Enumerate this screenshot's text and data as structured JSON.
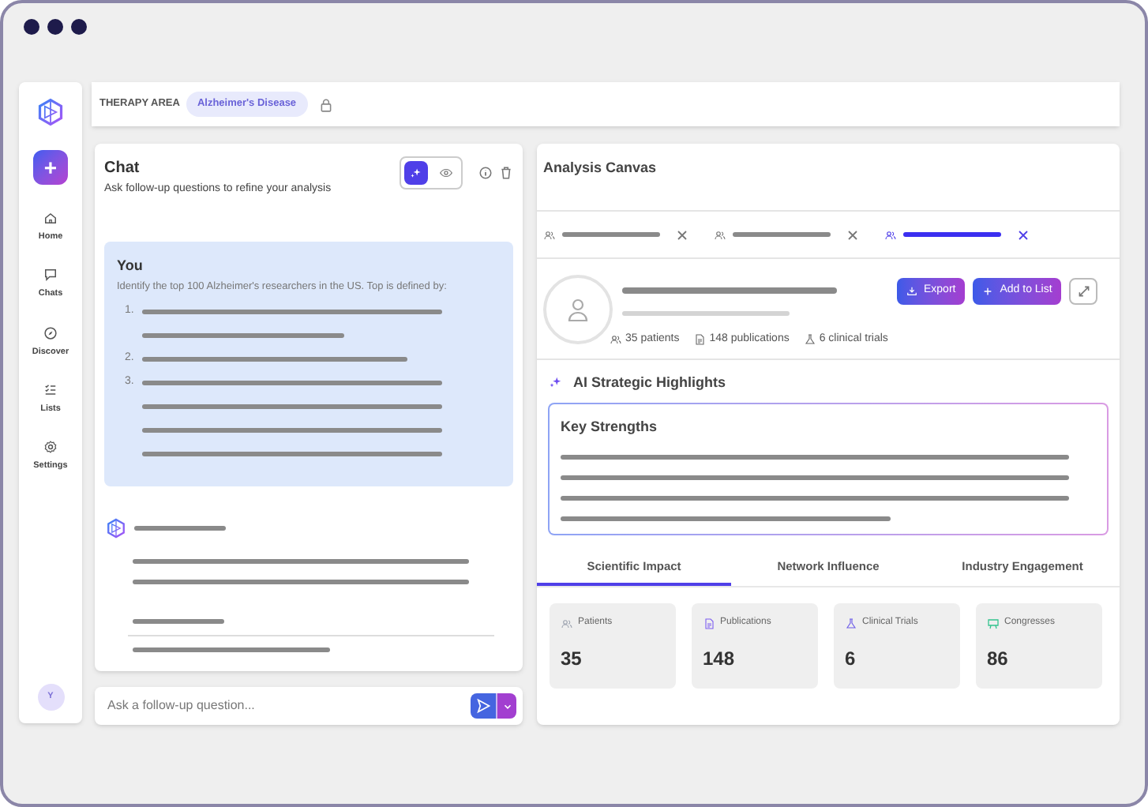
{
  "sidebar": {
    "new_button": "+",
    "items": [
      {
        "label": "Home",
        "kind": "home"
      },
      {
        "label": "Chats",
        "kind": "chats"
      },
      {
        "label": "Discover",
        "kind": "discover"
      },
      {
        "label": "Lists",
        "kind": "lists"
      },
      {
        "label": "Settings",
        "kind": "settings"
      }
    ],
    "avatar": "Y"
  },
  "header": {
    "label": "THERAPY AREA",
    "chip": "Alzheimer's Disease"
  },
  "chat": {
    "title": "Chat",
    "subtitle": "Ask follow-up questions to refine your analysis",
    "modes": [
      {
        "kind": "ai",
        "selected": true
      },
      {
        "kind": "view",
        "selected": false
      }
    ],
    "user_message": {
      "author": "You",
      "text": "Identify the top 100 Alzheimer's researchers in the US. Top is defined by:",
      "list_markers": [
        "1.",
        "2.",
        "3."
      ]
    },
    "input": {
      "placeholder": "Ask a follow-up question..."
    }
  },
  "canvas": {
    "title": "Analysis Canvas",
    "tabs": [
      {
        "selected": false
      },
      {
        "selected": false
      },
      {
        "selected": true
      }
    ],
    "stats": [
      {
        "kind": "patients",
        "text": "35 patients"
      },
      {
        "kind": "publications",
        "text": "148 publications"
      },
      {
        "kind": "trials",
        "text": "6 clinical trials"
      }
    ],
    "buttons": [
      {
        "kind": "export",
        "label": "Export"
      },
      {
        "kind": "add",
        "label": "Add to List"
      }
    ],
    "highlights_title": "AI Strategic Highlights",
    "card_title": "Key Strengths",
    "sections": [
      {
        "label": "Scientific Impact",
        "selected": true
      },
      {
        "label": "Network Influence",
        "selected": false
      },
      {
        "label": "Industry Engagement",
        "selected": false
      }
    ],
    "metrics": [
      {
        "kind": "patients",
        "label": "Patients",
        "value": "35"
      },
      {
        "kind": "publications",
        "label": "Publications",
        "value": "148"
      },
      {
        "kind": "trials",
        "label": "Clinical Trials",
        "value": "6"
      },
      {
        "kind": "congresses",
        "label": "Congresses",
        "value": "86"
      }
    ]
  }
}
